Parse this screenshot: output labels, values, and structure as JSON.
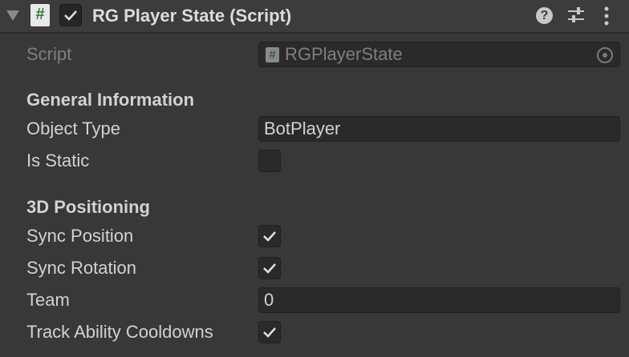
{
  "header": {
    "title": "RG Player State (Script)",
    "enabled": true
  },
  "script": {
    "label": "Script",
    "value": "RGPlayerState"
  },
  "general": {
    "heading": "General Information",
    "object_type_label": "Object Type",
    "object_type_value": "BotPlayer",
    "is_static_label": "Is Static",
    "is_static": false
  },
  "positioning": {
    "heading": "3D Positioning",
    "sync_position_label": "Sync Position",
    "sync_position": true,
    "sync_rotation_label": "Sync Rotation",
    "sync_rotation": true,
    "team_label": "Team",
    "team_value": "0",
    "track_label": "Track Ability Cooldowns",
    "track": true
  }
}
